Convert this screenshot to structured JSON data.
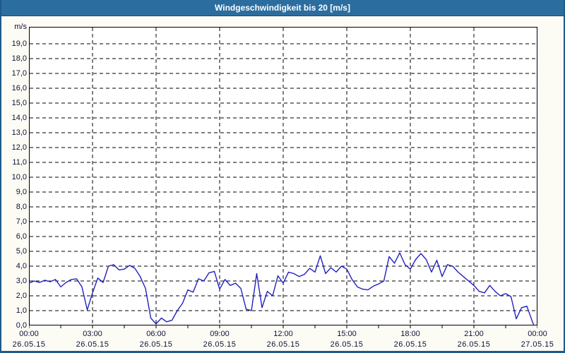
{
  "window": {
    "title": "Windgeschwindigkeit bis 20 [m/s]"
  },
  "colors": {
    "title_bar": "#2c6da0",
    "outer_frame": "#1e5a8a",
    "page_background": "#fcfcf5",
    "plot_background": "#ffffff",
    "gridlines": "#000000",
    "series_line": "#2121bf",
    "axis_text": "#101038",
    "title_text": "#ffffff"
  },
  "chart_data": {
    "type": "line",
    "title": "Windgeschwindigkeit bis 20 [m/s]",
    "y_unit": "m/s",
    "ylabel": "m/s",
    "xlabel": "",
    "ylim": [
      0,
      20.15
    ],
    "y_tick_step": 1.0,
    "y_tick_labels": [
      "0,0",
      "1,0",
      "2,0",
      "3,0",
      "4,0",
      "5,0",
      "6,0",
      "7,0",
      "8,0",
      "9,0",
      "10,0",
      "11,0",
      "12,0",
      "13,0",
      "14,0",
      "15,0",
      "16,0",
      "17,0",
      "18,0",
      "19,0"
    ],
    "grid": "dashed",
    "legend_position": "none",
    "x_range_minutes": 1440,
    "x_minor_tick_minutes": 90,
    "x_major_tick_hours": 3,
    "x_ticks": [
      {
        "time": "00:00",
        "date": "26.05.15"
      },
      {
        "time": "03:00",
        "date": "26.05.15"
      },
      {
        "time": "06:00",
        "date": "26.05.15"
      },
      {
        "time": "09:00",
        "date": "26.05.15"
      },
      {
        "time": "12:00",
        "date": "26.05.15"
      },
      {
        "time": "15:00",
        "date": "26.05.15"
      },
      {
        "time": "18:00",
        "date": "26.05.15"
      },
      {
        "time": "21:00",
        "date": "26.05.15"
      },
      {
        "time": "00:00",
        "date": "27.05.15"
      }
    ],
    "series": [
      {
        "name": "Windgeschwindigkeit",
        "x_times": [
          "00:00",
          "00:15",
          "00:30",
          "00:45",
          "01:00",
          "01:15",
          "01:30",
          "01:45",
          "02:00",
          "02:15",
          "02:30",
          "02:45",
          "03:00",
          "03:15",
          "03:30",
          "03:45",
          "04:00",
          "04:15",
          "04:30",
          "04:45",
          "05:00",
          "05:15",
          "05:30",
          "05:45",
          "06:00",
          "06:15",
          "06:30",
          "06:45",
          "07:00",
          "07:15",
          "07:30",
          "07:45",
          "08:00",
          "08:15",
          "08:30",
          "08:45",
          "09:00",
          "09:15",
          "09:30",
          "09:45",
          "10:00",
          "10:15",
          "10:30",
          "10:45",
          "11:00",
          "11:15",
          "11:30",
          "11:45",
          "12:00",
          "12:15",
          "12:30",
          "12:45",
          "13:00",
          "13:15",
          "13:30",
          "13:45",
          "14:00",
          "14:15",
          "14:30",
          "14:45",
          "15:00",
          "15:15",
          "15:30",
          "15:45",
          "16:00",
          "16:15",
          "16:30",
          "16:45",
          "17:00",
          "17:15",
          "17:30",
          "17:45",
          "18:00",
          "18:15",
          "18:30",
          "18:45",
          "19:00",
          "19:15",
          "19:30",
          "19:45",
          "20:00",
          "20:15",
          "20:30",
          "20:45",
          "21:00",
          "21:15",
          "21:30",
          "21:45",
          "22:00",
          "22:15",
          "22:30",
          "22:45",
          "23:00",
          "23:15",
          "23:30",
          "23:45",
          "23:50"
        ],
        "values": [
          2.85,
          3.0,
          2.9,
          3.05,
          2.95,
          3.1,
          2.6,
          2.9,
          3.1,
          3.15,
          2.6,
          1.05,
          2.2,
          3.2,
          2.9,
          4.0,
          4.1,
          3.75,
          3.8,
          4.05,
          3.85,
          3.3,
          2.5,
          0.5,
          0.1,
          0.5,
          0.25,
          0.35,
          1.0,
          1.5,
          2.4,
          2.25,
          3.15,
          3.0,
          3.55,
          3.65,
          2.45,
          3.1,
          2.7,
          2.85,
          2.5,
          1.1,
          1.0,
          3.5,
          1.2,
          2.3,
          2.0,
          3.35,
          2.85,
          3.6,
          3.5,
          3.3,
          3.45,
          3.85,
          3.6,
          4.7,
          3.5,
          3.9,
          3.6,
          4.0,
          3.8,
          3.1,
          2.6,
          2.45,
          2.4,
          2.65,
          2.8,
          3.0,
          4.65,
          4.2,
          4.9,
          4.1,
          3.8,
          4.45,
          4.85,
          4.45,
          3.6,
          4.4,
          3.3,
          4.1,
          4.0,
          3.6,
          3.3,
          3.0,
          2.7,
          2.3,
          2.2,
          2.7,
          2.3,
          2.0,
          2.15,
          1.95,
          0.45,
          1.2,
          1.3,
          0.3,
          0.0
        ]
      }
    ]
  }
}
